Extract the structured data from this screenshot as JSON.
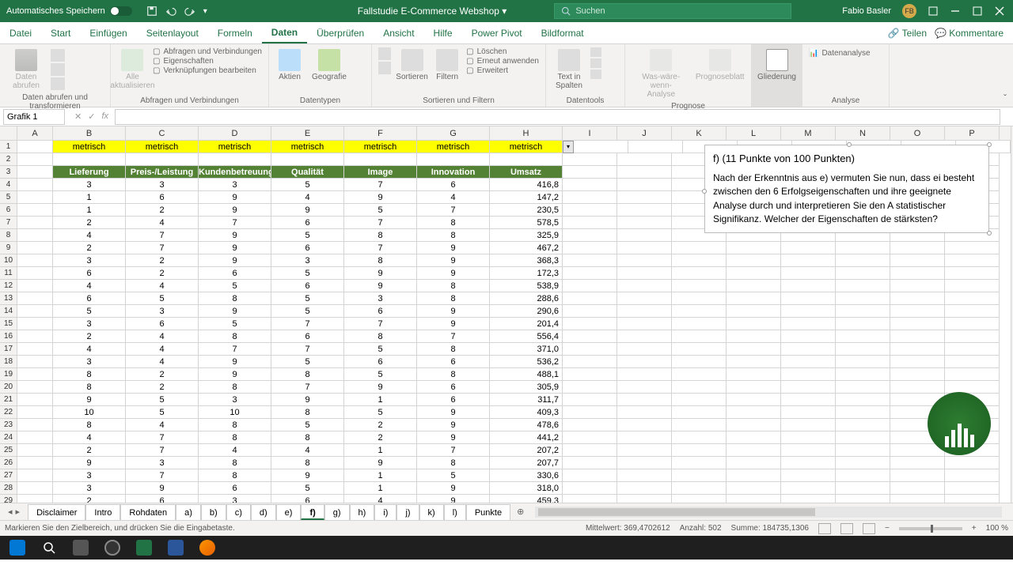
{
  "titlebar": {
    "autosave": "Automatisches Speichern",
    "doc": "Fallstudie E-Commerce Webshop",
    "search_placeholder": "Suchen",
    "user": "Fabio Basler",
    "initials": "FB"
  },
  "tabs": {
    "items": [
      "Datei",
      "Start",
      "Einfügen",
      "Seitenlayout",
      "Formeln",
      "Daten",
      "Überprüfen",
      "Ansicht",
      "Hilfe",
      "Power Pivot",
      "Bildformat"
    ],
    "active": 5,
    "share": "Teilen",
    "comments": "Kommentare"
  },
  "ribbon": {
    "g1": {
      "label": "Daten abrufen und transformieren",
      "b1": "Daten\nabrufen"
    },
    "g2": {
      "label": "Abfragen und Verbindungen",
      "b1": "Alle\naktualisieren",
      "l1": "Abfragen und Verbindungen",
      "l2": "Eigenschaften",
      "l3": "Verknüpfungen bearbeiten"
    },
    "g3": {
      "label": "Datentypen",
      "b1": "Aktien",
      "b2": "Geografie"
    },
    "g4": {
      "label": "Sortieren und Filtern",
      "b1": "Sortieren",
      "b2": "Filtern",
      "l1": "Löschen",
      "l2": "Erneut anwenden",
      "l3": "Erweitert"
    },
    "g5": {
      "label": "Datentools",
      "b1": "Text in\nSpalten"
    },
    "g6": {
      "label": "Prognose",
      "b1": "Was-wäre-wenn-\nAnalyse",
      "b2": "Prognoseblatt"
    },
    "g7": {
      "label": "",
      "b1": "Gliederung"
    },
    "g8": {
      "label": "Analyse",
      "b1": "Datenanalyse"
    }
  },
  "formula": {
    "name": "Grafik 1"
  },
  "columns": [
    "A",
    "B",
    "C",
    "D",
    "E",
    "F",
    "G",
    "H",
    "I",
    "J",
    "K",
    "L",
    "M",
    "N",
    "O",
    "P"
  ],
  "row1": {
    "label": "metrisch"
  },
  "headers": [
    "Lieferung",
    "Preis-/Leistung",
    "Kundenbetreuung",
    "Qualität",
    "Image",
    "Innovation",
    "Umsatz"
  ],
  "data": [
    [
      3,
      3,
      3,
      5,
      7,
      6,
      "416,8"
    ],
    [
      1,
      6,
      9,
      4,
      9,
      4,
      "147,2"
    ],
    [
      1,
      2,
      9,
      9,
      5,
      7,
      "230,5"
    ],
    [
      2,
      4,
      7,
      6,
      7,
      8,
      "578,5"
    ],
    [
      4,
      7,
      9,
      5,
      8,
      8,
      "325,9"
    ],
    [
      2,
      7,
      9,
      6,
      7,
      9,
      "467,2"
    ],
    [
      3,
      2,
      9,
      3,
      8,
      9,
      "368,3"
    ],
    [
      6,
      2,
      6,
      5,
      9,
      9,
      "172,3"
    ],
    [
      4,
      4,
      5,
      6,
      9,
      8,
      "538,9"
    ],
    [
      6,
      5,
      8,
      5,
      3,
      8,
      "288,6"
    ],
    [
      5,
      3,
      9,
      5,
      6,
      9,
      "290,6"
    ],
    [
      3,
      6,
      5,
      7,
      7,
      9,
      "201,4"
    ],
    [
      2,
      4,
      8,
      6,
      8,
      7,
      "556,4"
    ],
    [
      4,
      4,
      7,
      7,
      5,
      8,
      "371,0"
    ],
    [
      3,
      4,
      9,
      5,
      6,
      6,
      "536,2"
    ],
    [
      8,
      2,
      9,
      8,
      5,
      8,
      "488,1"
    ],
    [
      8,
      2,
      8,
      7,
      9,
      6,
      "305,9"
    ],
    [
      9,
      5,
      3,
      9,
      1,
      6,
      "311,7"
    ],
    [
      10,
      5,
      10,
      8,
      5,
      9,
      "409,3"
    ],
    [
      8,
      4,
      8,
      5,
      2,
      9,
      "478,6"
    ],
    [
      4,
      7,
      8,
      8,
      2,
      9,
      "441,2"
    ],
    [
      2,
      7,
      4,
      4,
      1,
      7,
      "207,2"
    ],
    [
      9,
      3,
      8,
      8,
      9,
      8,
      "207,7"
    ],
    [
      3,
      7,
      8,
      9,
      1,
      5,
      "330,6"
    ],
    [
      3,
      9,
      6,
      5,
      1,
      9,
      "318,0"
    ],
    [
      2,
      6,
      3,
      6,
      4,
      9,
      "459,3"
    ]
  ],
  "textbox": {
    "title": "f) (11 Punkte von 100 Punkten)",
    "body": "Nach der Erkenntnis aus e) vermuten Sie nun, dass ei besteht zwischen den 6 Erfolgseigenschaften und ihre geeignete Analyse durch und interpretieren Sie den A statistischer Signifikanz. Welcher der Eigenschaften de stärksten?"
  },
  "sheets": {
    "items": [
      "Disclaimer",
      "Intro",
      "Rohdaten",
      "a)",
      "b)",
      "c)",
      "d)",
      "e)",
      "f)",
      "g)",
      "h)",
      "i)",
      "j)",
      "k)",
      "l)",
      "Punkte"
    ],
    "active": 8
  },
  "status": {
    "msg": "Markieren Sie den Zielbereich, und drücken Sie die Eingabetaste.",
    "avg_label": "Mittelwert:",
    "avg": "369,4702612",
    "count_label": "Anzahl:",
    "count": "502",
    "sum_label": "Summe:",
    "sum": "184735,1306",
    "zoom": "100 %"
  }
}
